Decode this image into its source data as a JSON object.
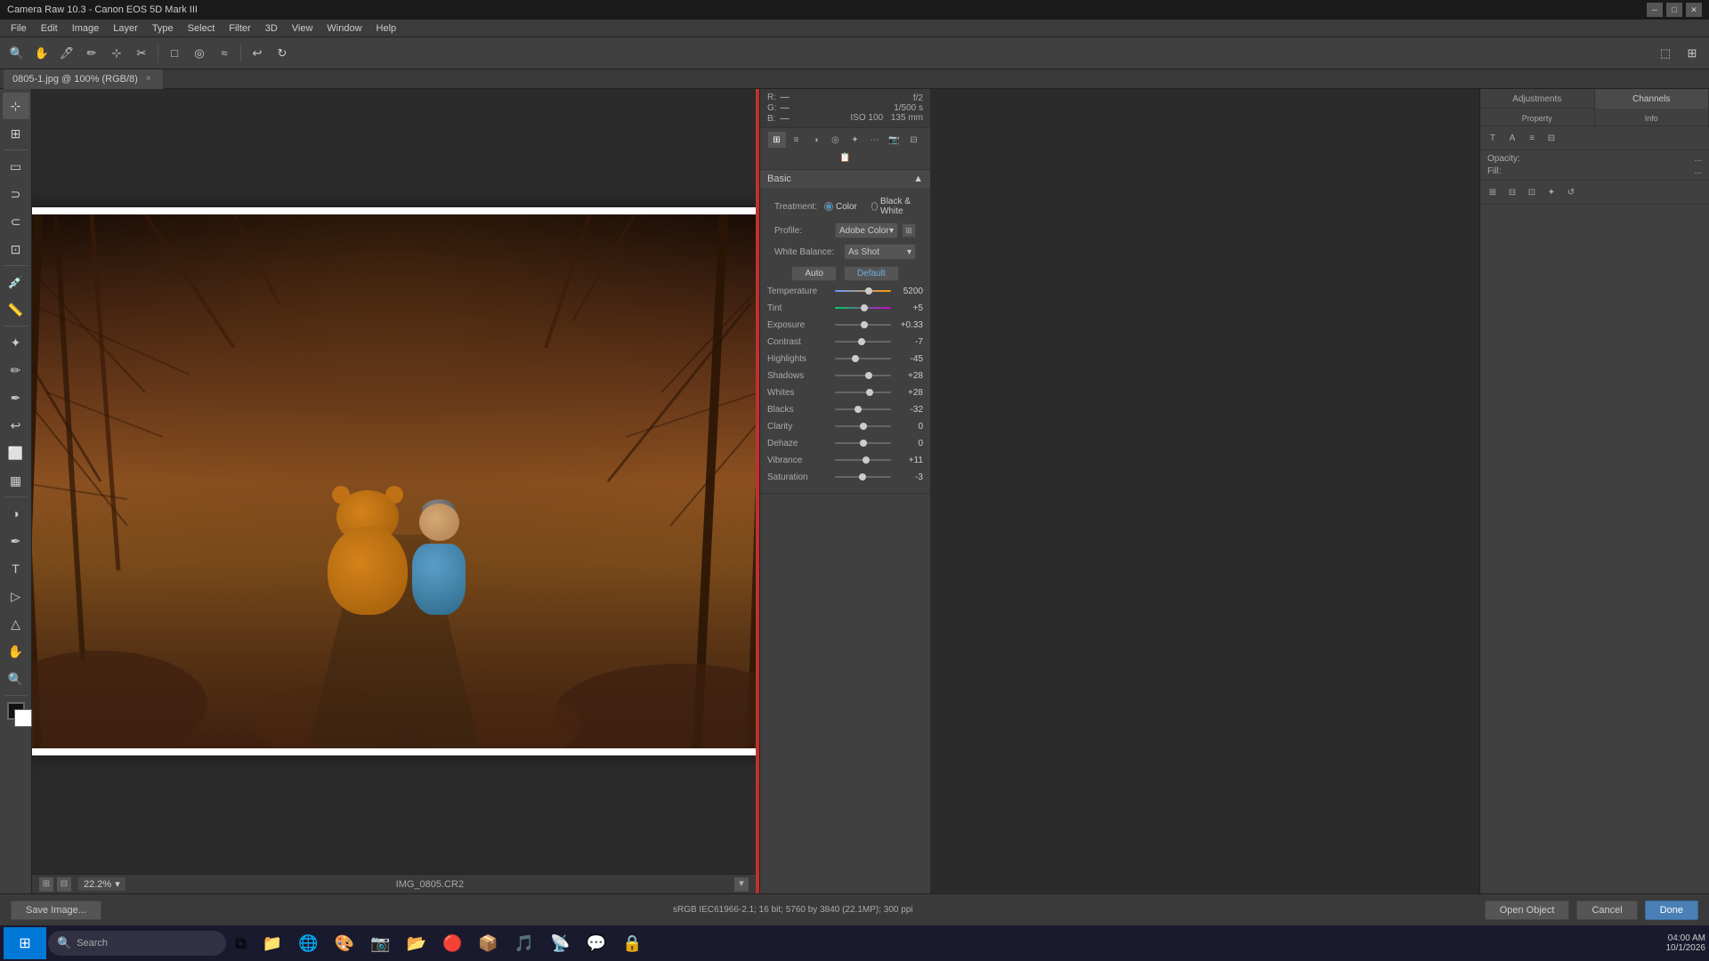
{
  "titlebar": {
    "title": "Camera Raw 10.3 - Canon EOS 5D Mark III",
    "minimize": "─",
    "maximize": "□",
    "close": "✕"
  },
  "menubar": {
    "items": [
      "File",
      "Edit",
      "Image",
      "Layer",
      "Type",
      "Select",
      "Filter",
      "3D",
      "View",
      "Window",
      "Help"
    ]
  },
  "toolbar": {
    "tools": [
      "🔍",
      "✋",
      "🖊",
      "✏",
      "📐",
      "✂",
      "□",
      "◎",
      "≡",
      "↩",
      "↻"
    ]
  },
  "tabs": {
    "items": [
      {
        "name": "0805-1.jpg @ 100% (RGB/8)",
        "close": "×"
      }
    ]
  },
  "leftpanel": {
    "tools": [
      "M",
      "✋",
      "🖊",
      "✏",
      "🔲",
      "◻",
      "🅻",
      "T",
      "🖐",
      "A",
      "⬤",
      "▨"
    ]
  },
  "canvas": {
    "filename": "IMG_0805.CR2",
    "zoom": "22.2%",
    "status_info": "sRGB IEC61966-2.1; 16 bit; 5760 by 3840 (22.1MP); 300 ppi"
  },
  "camera_raw": {
    "info": {
      "r_label": "R:",
      "g_label": "G:",
      "b_label": "B:",
      "r_value": "—",
      "g_value": "—",
      "b_value": "—",
      "aperture": "f/2",
      "shutter": "1/500 s",
      "iso": "ISO 100",
      "focal": "135 mm"
    },
    "section": "Basic",
    "treatment_label": "Treatment:",
    "color_option": "Color",
    "bw_option": "Black & White",
    "profile_label": "Profile:",
    "profile_value": "Adobe Color",
    "wb_label": "White Balance:",
    "wb_value": "As Shot",
    "auto_label": "Auto",
    "default_label": "Default",
    "adjustments": [
      {
        "label": "Temperature",
        "value": "5200",
        "pct": 60,
        "track": "temp"
      },
      {
        "label": "Tint",
        "value": "+5",
        "pct": 52,
        "track": "tint"
      },
      {
        "label": "Exposure",
        "value": "+0.33",
        "pct": 53,
        "track": "normal"
      },
      {
        "label": "Contrast",
        "value": "-7",
        "pct": 48,
        "track": "normal"
      },
      {
        "label": "Highlights",
        "value": "-45",
        "pct": 36,
        "track": "normal"
      },
      {
        "label": "Shadows",
        "value": "+28",
        "pct": 61,
        "track": "normal"
      },
      {
        "label": "Whites",
        "value": "+28",
        "pct": 62,
        "track": "normal"
      },
      {
        "label": "Blacks",
        "value": "-32",
        "pct": 42,
        "track": "normal"
      },
      {
        "label": "Clarity",
        "value": "0",
        "pct": 50,
        "track": "normal"
      },
      {
        "label": "Dehaze",
        "value": "0",
        "pct": 50,
        "track": "normal"
      },
      {
        "label": "Vibrance",
        "value": "+11",
        "pct": 56,
        "track": "normal"
      },
      {
        "label": "Saturation",
        "value": "-3",
        "pct": 49,
        "track": "normal"
      }
    ]
  },
  "right_panel": {
    "tabs": [
      "Adjustments",
      "Channels"
    ],
    "properties_tab": "Property",
    "info_tab": "Info"
  },
  "bottom_bar": {
    "save_label": "Save Image...",
    "open_object_label": "Open Object",
    "cancel_label": "Cancel",
    "done_label": "Done"
  },
  "taskbar": {
    "start_icon": "⊞",
    "search_placeholder": "Search",
    "apps": [
      "🖥",
      "🔍",
      "📁",
      "🌐",
      "⭐",
      "🎨",
      "📷",
      "📁",
      "🔴",
      "📦",
      "🎵",
      "📡",
      "🃏",
      "🔒"
    ],
    "time": "..."
  }
}
